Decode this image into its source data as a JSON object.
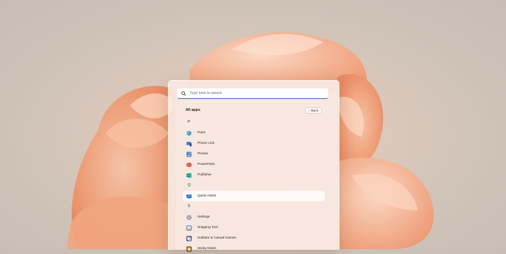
{
  "search": {
    "placeholder": "Type here to search"
  },
  "list": {
    "heading": "All apps",
    "back_label": "Back",
    "sections": [
      {
        "letter": "P",
        "apps": [
          "Paint",
          "Phone Link",
          "Photos",
          "PowerPoint",
          "Publisher"
        ]
      },
      {
        "letter": "Q",
        "apps": [
          "Quick Assist"
        ]
      },
      {
        "letter": "S",
        "apps": [
          "Settings",
          "Snipping Tool",
          "Solitaire & Casual Games",
          "Sticky Notes"
        ]
      }
    ]
  },
  "icons": {
    "paint": "paint-icon",
    "phone_link": "phone-link-icon",
    "photos": "photos-icon",
    "powerpoint": "powerpoint-icon",
    "publisher": "publisher-icon",
    "quick_assist": "quick-assist-icon",
    "settings": "settings-icon",
    "snipping_tool": "snipping-tool-icon",
    "solitaire": "solitaire-icon",
    "sticky_notes": "sticky-notes-icon"
  },
  "colors": {
    "search_underline": "#2f6fb3",
    "highlight": "#ffffff",
    "bloom": "#f0a880"
  }
}
